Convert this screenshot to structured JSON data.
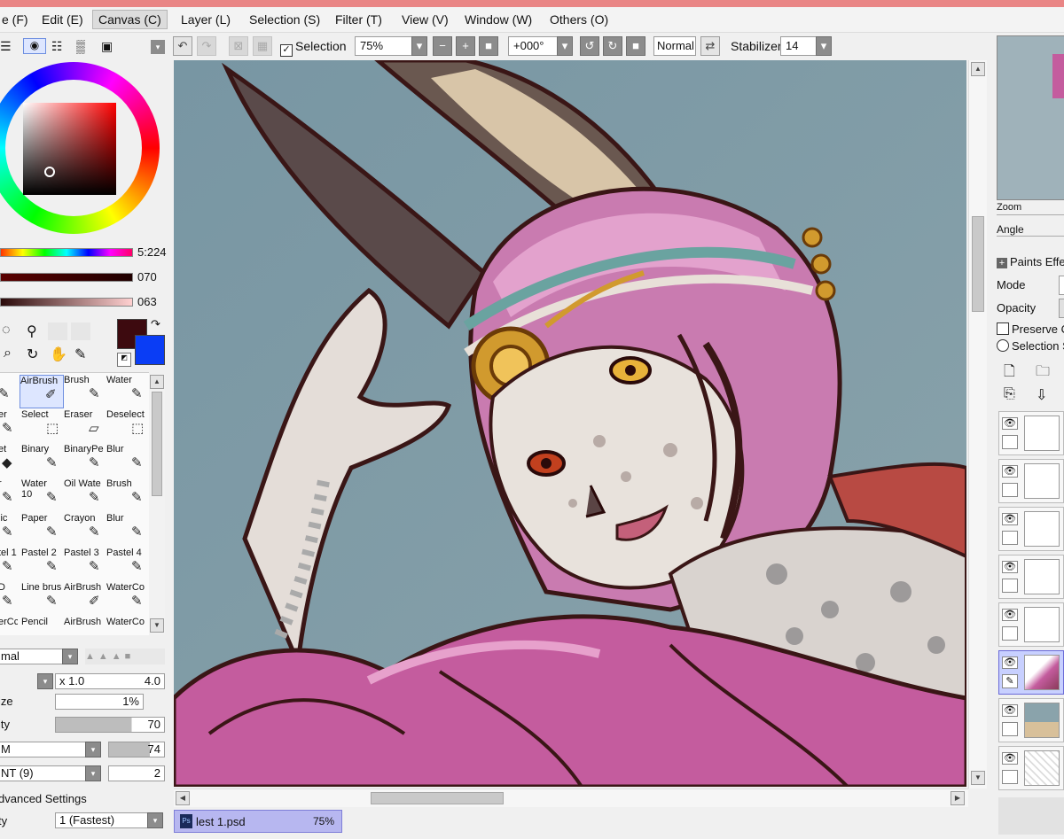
{
  "menubar": {
    "items": [
      "e (F)",
      "Edit (E)",
      "Canvas (C)",
      "Layer (L)",
      "Selection (S)",
      "Filter (T)",
      "View (V)",
      "Window (W)",
      "Others (O)"
    ]
  },
  "toolbar": {
    "selection_label": "Selection",
    "zoom_value": "75%",
    "rotation_value": "+000°",
    "blend_mode": "Normal",
    "stabilizer_label": "Stabilizer",
    "stabilizer_value": "14"
  },
  "color_panel": {
    "slider_values": [
      "5:224",
      "070",
      "063"
    ],
    "primary_color": "#3d0a0f",
    "secondary_color": "#0a3df5"
  },
  "tool_grid": [
    [
      "AirBrush",
      "Brush",
      "Water"
    ],
    [
      "er",
      "Select",
      "Eraser",
      "Deselect"
    ],
    [
      "et",
      "Binary",
      "BinaryPe",
      "Blur"
    ],
    [
      "r",
      "Water",
      "Oil Wate",
      "Brush"
    ],
    [
      "",
      "10",
      "",
      ""
    ],
    [
      "lic",
      "Paper",
      "Crayon",
      "Blur"
    ],
    [
      "tel 1",
      "Pastel 2",
      "Pastel 3",
      "Pastel 4"
    ],
    [
      "D",
      "Line brus",
      "AirBrush",
      "WaterCo"
    ],
    [
      "erCc",
      "Pencil",
      "AirBrush",
      "WaterCo"
    ]
  ],
  "brush_settings": {
    "blend": "mal",
    "size_multiplier": "x 1.0",
    "size_value": "4.0",
    "min_size_label": "ize",
    "min_size_value": "1%",
    "density_label": "ity",
    "density_value": "70",
    "texture_value": "M",
    "texture_amount": "74",
    "paint_value": "NT  (9)",
    "paint_amount": "2",
    "advanced_label": "dvanced Settings",
    "quality_label": "ty",
    "quality_value": "1 (Fastest)"
  },
  "document_tab": {
    "name": "lest 1.psd",
    "zoom": "75%"
  },
  "right_panel": {
    "zoom_label": "Zoom",
    "angle_label": "Angle",
    "paint_effects_label": "Paints Effe",
    "mode_label": "Mode",
    "opacity_label": "Opacity",
    "preserve_label": "Preserve O",
    "selection_source_label": "Selection S",
    "layer_count": 8
  }
}
